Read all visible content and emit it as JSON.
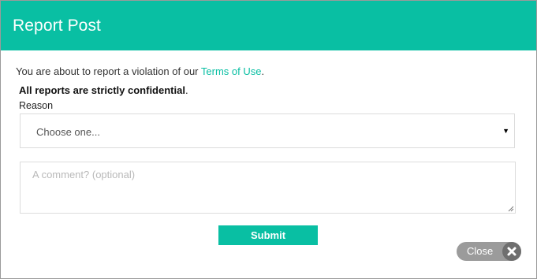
{
  "modal": {
    "title": "Report Post",
    "intro_prefix": "You are about to report a violation of our ",
    "terms_link": "Terms of Use",
    "intro_suffix": ".",
    "confidential_bold": "All reports are strictly confidential",
    "confidential_suffix": ".",
    "reason_label": "Reason",
    "reason_select_value": "Choose one...",
    "comment_placeholder": "A comment? (optional)",
    "submit_label": "Submit",
    "close_label": "Close"
  },
  "colors": {
    "accent": "#09bfa3",
    "close_button": "#9b9b9b",
    "close_icon_bg": "#6f6f6f"
  },
  "icons": {
    "dropdown": "caret-down-icon",
    "close": "close-icon",
    "resize": "resize-grip-icon"
  }
}
